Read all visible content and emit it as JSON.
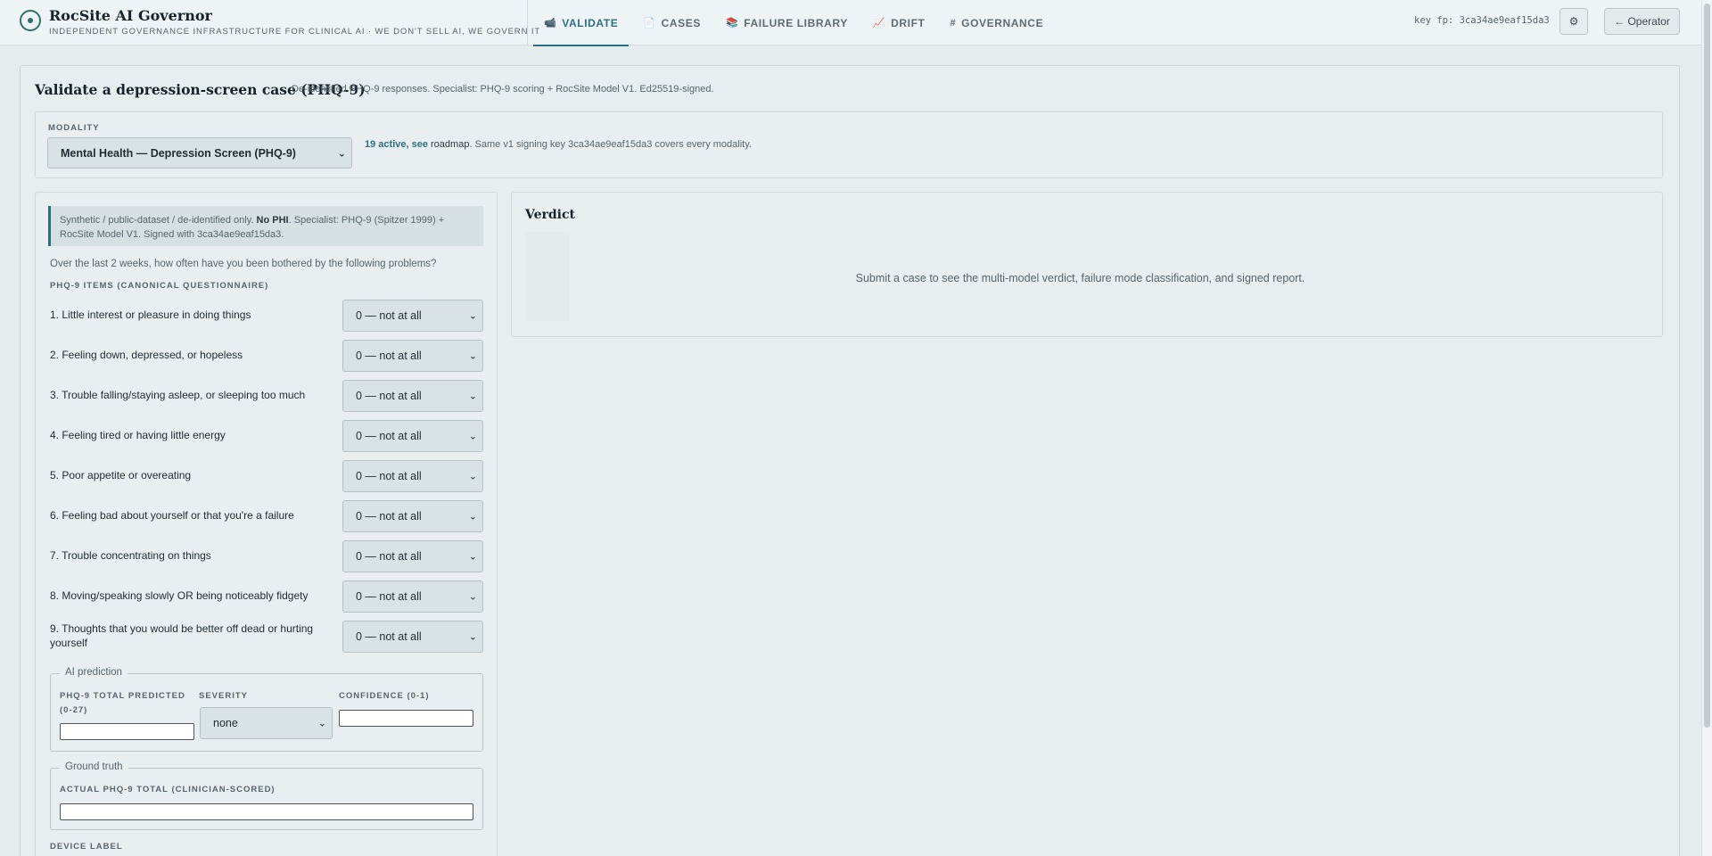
{
  "brand": {
    "title": "RocSite AI Governor",
    "subtitle": "INDEPENDENT GOVERNANCE INFRASTRUCTURE FOR CLINICAL AI · WE DON'T SELL AI, WE GOVERN IT"
  },
  "nav": {
    "tabs": [
      {
        "icon": "📹",
        "icon_name": "camera-icon",
        "label": "VALIDATE",
        "active": true
      },
      {
        "icon": "📄",
        "icon_name": "document-icon",
        "label": "CASES"
      },
      {
        "icon": "📚",
        "icon_name": "books-icon",
        "label": "FAILURE LIBRARY"
      },
      {
        "icon": "📈",
        "icon_name": "chart-up-icon",
        "label": "DRIFT"
      },
      {
        "icon": "#",
        "icon_name": "hash-icon",
        "label": "GOVERNANCE"
      }
    ]
  },
  "header_right": {
    "key_fp": "key fp: 3ca34ae9eaf15da3",
    "gear_icon": "⚙",
    "operator_label": "← Operator"
  },
  "page": {
    "title": "Validate a depression-screen case (PHQ-9)",
    "subtitle": "De-identified PHQ-9 responses. Specialist: PHQ-9 scoring + RocSite Model V1. Ed25519-signed."
  },
  "modality": {
    "label": "MODALITY",
    "selected": "Mental Health — Depression Screen (PHQ-9)",
    "active_count": "19 active",
    "see": ", see",
    "roadmap": "roadmap",
    "note": ". Same v1 signing key 3ca34ae9eaf15da3 covers every modality."
  },
  "notice": {
    "before": "Synthetic / public-dataset / de-identified only. ",
    "bold": "No PHI",
    "after": ". Specialist: PHQ-9 (Spitzer 1999) + RocSite Model V1. Signed with 3ca34ae9eaf15da3."
  },
  "question": "Over the last 2 weeks, how often have you been bothered by the following problems?",
  "items_label": "PHQ-9 ITEMS (CANONICAL QUESTIONNAIRE)",
  "items": [
    {
      "text": "1. Little interest or pleasure in doing things",
      "value": "0 — not at all"
    },
    {
      "text": "2. Feeling down, depressed, or hopeless",
      "value": "0 — not at all"
    },
    {
      "text": "3. Trouble falling/staying asleep, or sleeping too much",
      "value": "0 — not at all"
    },
    {
      "text": "4. Feeling tired or having little energy",
      "value": "0 — not at all"
    },
    {
      "text": "5. Poor appetite or overeating",
      "value": "0 — not at all"
    },
    {
      "text": "6. Feeling bad about yourself or that you're a failure",
      "value": "0 — not at all"
    },
    {
      "text": "7. Trouble concentrating on things",
      "value": "0 — not at all"
    },
    {
      "text": "8. Moving/speaking slowly OR being noticeably fidgety",
      "value": "0 — not at all"
    },
    {
      "text": "9. Thoughts that you would be better off dead or hurting yourself",
      "value": "0 — not at all"
    }
  ],
  "ai_prediction": {
    "legend": "AI prediction",
    "total_label": "PHQ-9 TOTAL PREDICTED (0-27)",
    "total_value": "",
    "severity_label": "SEVERITY",
    "severity_value": "none",
    "confidence_label": "CONFIDENCE (0-1)",
    "confidence_value": ""
  },
  "ground_truth": {
    "legend": "Ground truth",
    "actual_label": "ACTUAL PHQ-9 TOTAL (CLINICIAN-SCORED)",
    "actual_value": ""
  },
  "device_label": "DEVICE LABEL",
  "verdict": {
    "title": "Verdict",
    "message": "Submit a case to see the multi-model verdict, failure mode classification, and signed report."
  },
  "colors": {
    "accent": "#2b6f7e",
    "background": "#e4ecee"
  }
}
